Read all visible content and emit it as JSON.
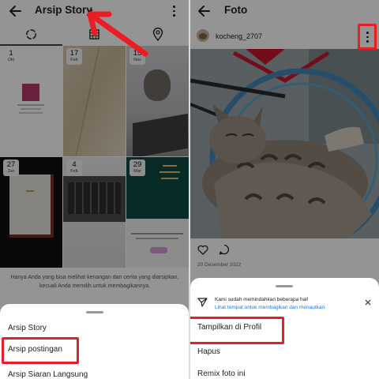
{
  "left": {
    "header": {
      "title": "Arsip Story"
    },
    "tabs": [
      {
        "name": "story",
        "icon": "circle-dashed-icon"
      },
      {
        "name": "postingan",
        "icon": "grid-icon"
      },
      {
        "name": "peta",
        "icon": "location-pin-icon"
      }
    ],
    "cells": [
      {
        "day": "1",
        "month": "Okt"
      },
      {
        "day": "17",
        "month": "Feb"
      },
      {
        "day": "15",
        "month": "Nov"
      },
      {
        "day": "27",
        "month": "Jun"
      },
      {
        "day": "4",
        "month": "Feb"
      },
      {
        "day": "29",
        "month": "Mar"
      }
    ],
    "caption": "Hanya Anda yang bisa melihat kenangan dan cerita yang diarsipkan, kecuali Anda memilih untuk membagikannya.",
    "menu": [
      "Arsip Story",
      "Arsip postingan",
      "Arsip Siaran Langsung"
    ]
  },
  "right": {
    "header": {
      "title": "Foto"
    },
    "username": "kocheng_2707",
    "post_date": "20 Desember 2022",
    "notice": {
      "text": "Kami sudah memindahkan beberapa hal!",
      "link": "Lihat tempat untuk membagikan dan menautkan"
    },
    "menu": [
      "Tampilkan di Profil",
      "Hapus",
      "Remix foto ini"
    ]
  },
  "colors": {
    "highlight_red": "#ec1c24",
    "link_blue": "#1877f2"
  }
}
